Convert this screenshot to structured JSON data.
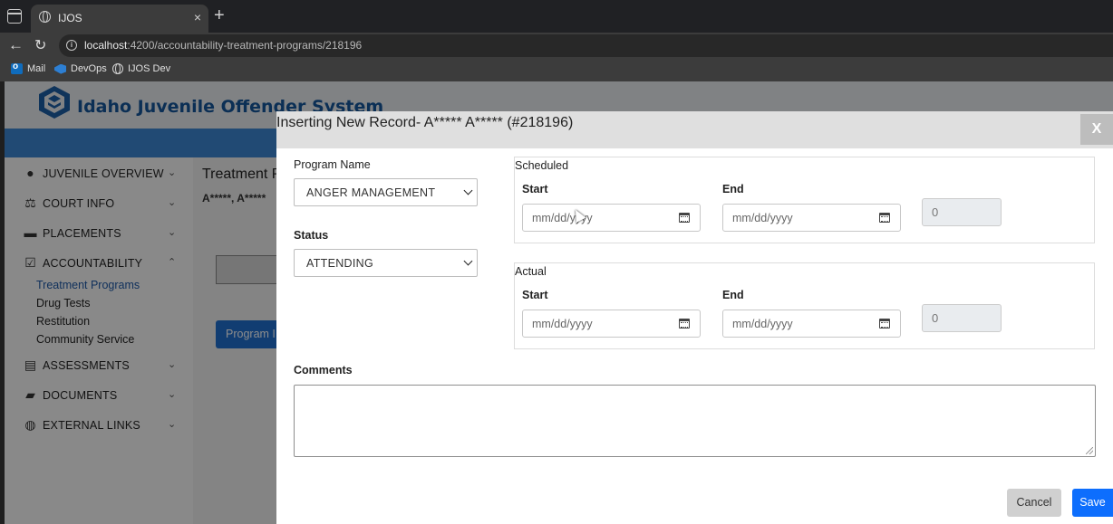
{
  "browser": {
    "tab_title": "IJOS",
    "tab_close": "×",
    "new_tab": "+",
    "url_host": "localhost",
    "url_path": ":4200/accountability-treatment-programs/218196",
    "bookmarks": [
      "Mail",
      "DevOps",
      "IJOS Dev"
    ]
  },
  "app": {
    "title": "Idaho Juvenile Offender System",
    "page_title": "Treatment P",
    "page_subtitle": "A*****, A*****",
    "ghost_button": "Program I"
  },
  "sidebar": {
    "items": [
      {
        "label": "JUVENILE OVERVIEW",
        "icon": "person-icon",
        "chevron": "down"
      },
      {
        "label": "COURT INFO",
        "icon": "scales-icon",
        "chevron": "down"
      },
      {
        "label": "PLACEMENTS",
        "icon": "bed-icon",
        "chevron": "down"
      },
      {
        "label": "ACCOUNTABILITY",
        "icon": "checklist-icon",
        "chevron": "up"
      },
      {
        "label": "ASSESSMENTS",
        "icon": "clipboard-icon",
        "chevron": "down"
      },
      {
        "label": "DOCUMENTS",
        "icon": "folder-icon",
        "chevron": "down"
      },
      {
        "label": "EXTERNAL LINKS",
        "icon": "globe-icon",
        "chevron": "down"
      }
    ],
    "accountability_sub": [
      "Treatment Programs",
      "Drug Tests",
      "Restitution",
      "Community Service"
    ],
    "active_sub": "Treatment Programs"
  },
  "modal": {
    "title": "Inserting New Record- A***** A***** (#218196)",
    "close_label": "X",
    "program_name_label": "Program Name",
    "program_name_value": "ANGER MANAGEMENT",
    "status_label": "Status",
    "status_value": "ATTENDING",
    "scheduled": {
      "legend": "Scheduled",
      "start_label": "Start",
      "end_label": "End",
      "start_placeholder": "mm/dd/yyyy",
      "end_placeholder": "mm/dd/yyyy",
      "days": "0"
    },
    "actual": {
      "legend": "Actual",
      "start_label": "Start",
      "end_label": "End",
      "start_placeholder": "mm/dd/yyyy",
      "end_placeholder": "mm/dd/yyyy",
      "days": "0"
    },
    "comments_label": "Comments",
    "cancel_label": "Cancel",
    "save_label": "Save"
  },
  "colors": {
    "brand_blue": "#15569b",
    "header_strip": "#3c88d4",
    "primary_button": "#0d6efd",
    "active_link": "#1f5aa8"
  }
}
